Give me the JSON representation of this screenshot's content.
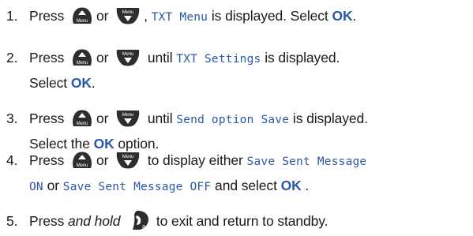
{
  "steps": [
    {
      "number": "1.",
      "press": "Press",
      "or": "or",
      "comma": ",",
      "lcd": "TXT Menu",
      "tail": " is displayed. Select ",
      "ok": "OK",
      "end": "."
    },
    {
      "number": "2.",
      "press": "Press",
      "or": "or",
      "until": " until ",
      "lcd": "TXT Settings",
      "tail": " is displayed.",
      "line2": "Select ",
      "ok": "OK",
      "end": "."
    },
    {
      "number": "3.",
      "press": "Press",
      "or": "or",
      "until": " until ",
      "lcd": "Send option Save",
      "tail": " is displayed.",
      "line2": "Select the ",
      "ok": "OK",
      "end": " option."
    },
    {
      "number": "4.",
      "press": "Press",
      "or": "or",
      "tail": " to display either ",
      "lcd": "Save Sent Message",
      "lcd2": "ON",
      "mid": " or ",
      "lcd3": "Save Sent Message OFF",
      "tail2": " and select ",
      "ok": "OK",
      "end": " ."
    },
    {
      "number": "5.",
      "press": "Press ",
      "em": "and hold",
      "tail": " to exit and return to standby."
    }
  ],
  "icons": {
    "up_key_label": "Menu",
    "down_key_label": "Menu",
    "end_key_label": "a"
  },
  "colors": {
    "accent": "#2b57a8",
    "key_fill": "#2d2d2d"
  }
}
